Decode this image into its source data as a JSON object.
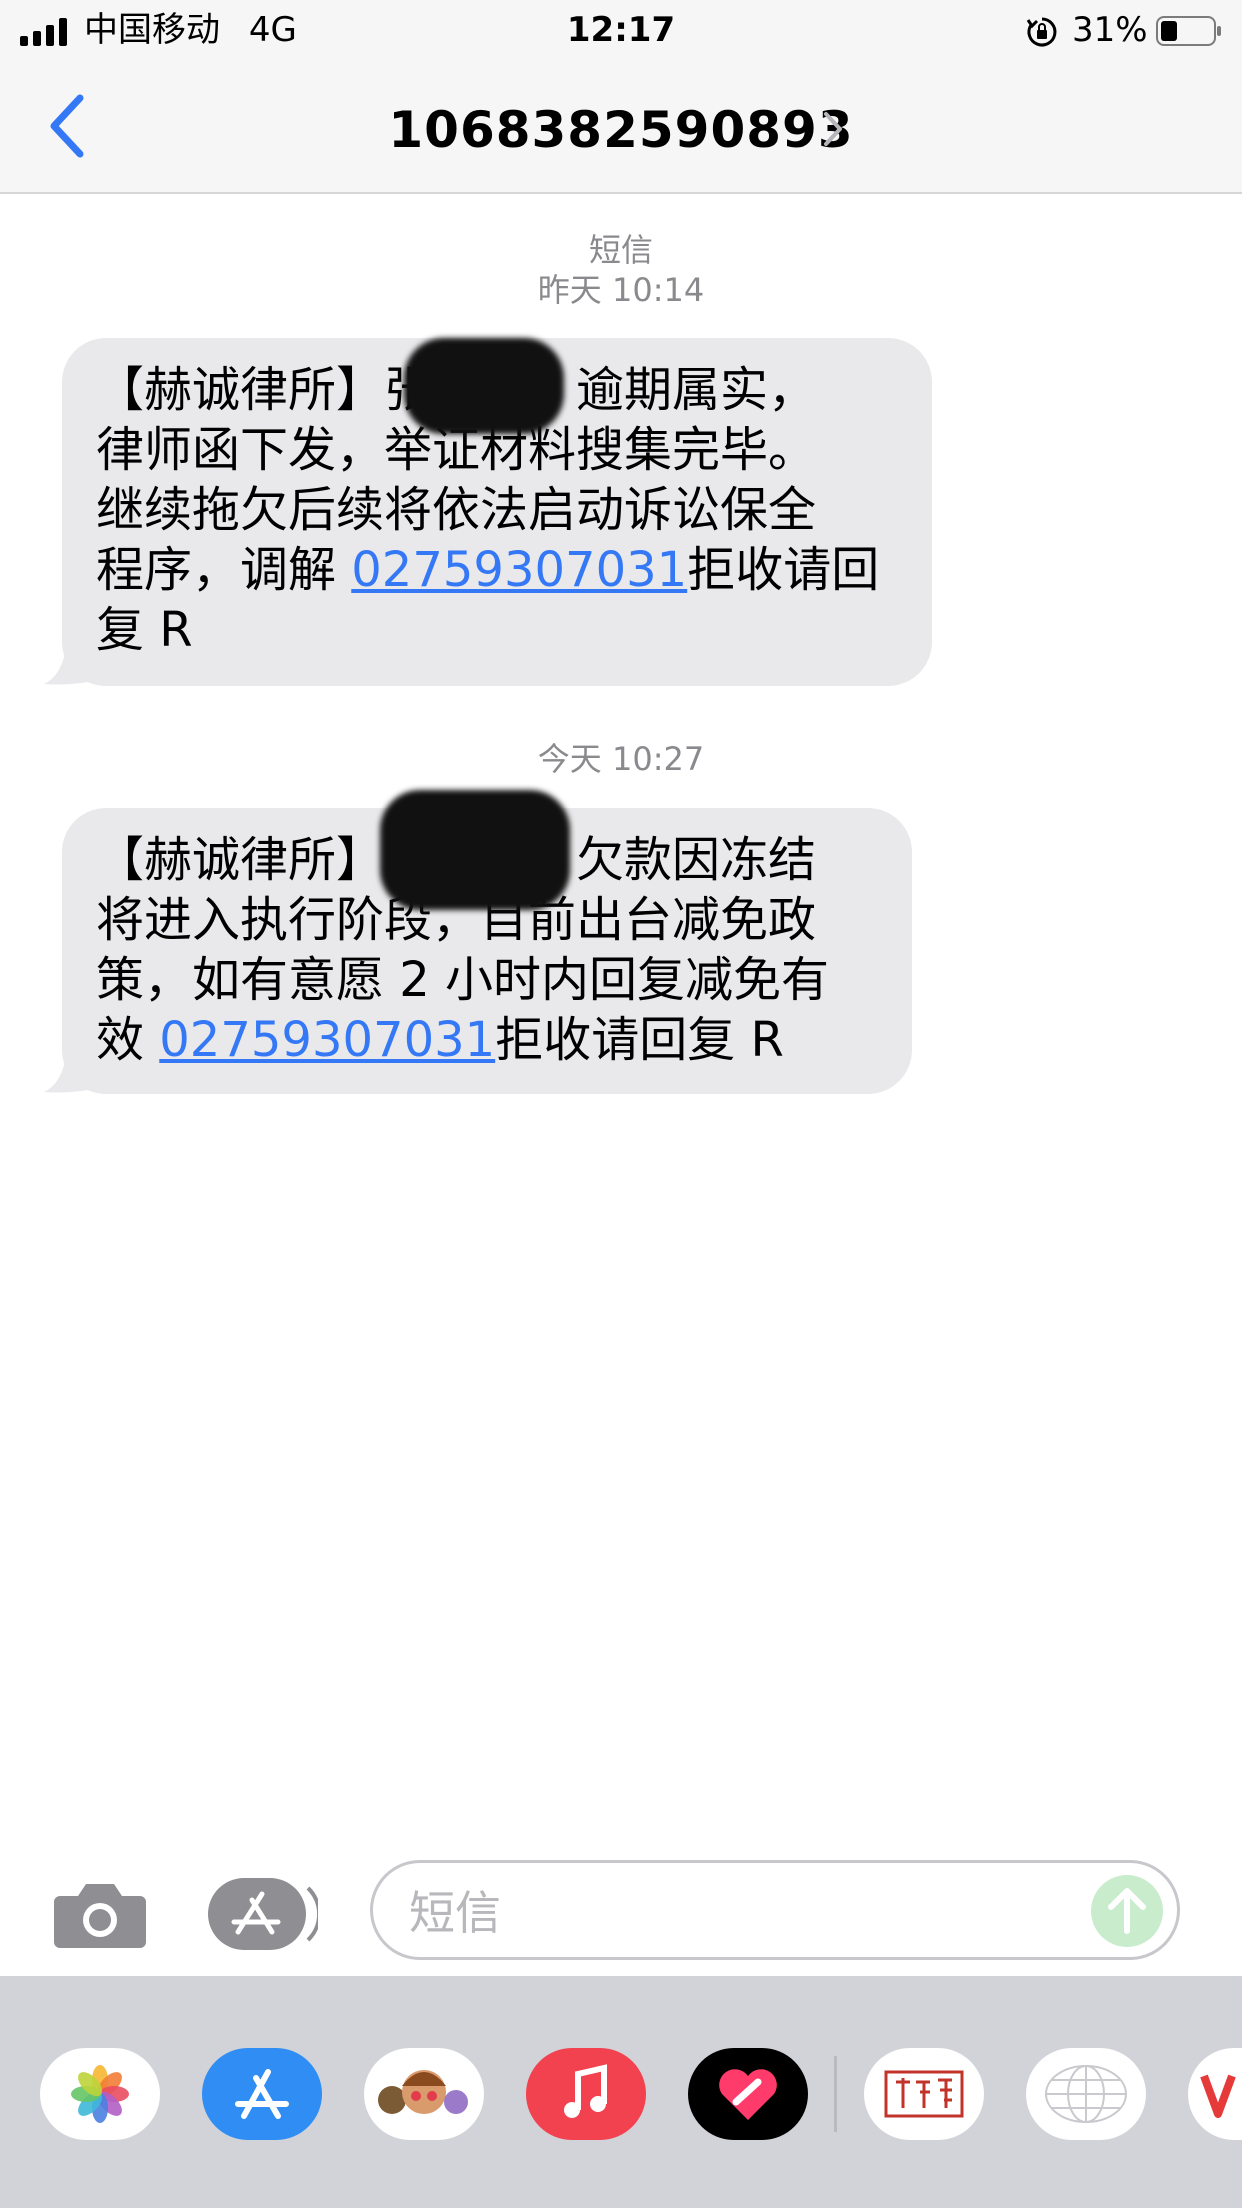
{
  "status_bar": {
    "carrier": "中国移动",
    "network": "4G",
    "time": "12:17",
    "battery_percent": "31%",
    "battery_level": 0.31
  },
  "nav": {
    "contact": "1068382590893"
  },
  "conversation": {
    "groups": [
      {
        "label": "短信",
        "timestamp": "昨天 10:14",
        "message": {
          "lines_before_link": [
            "【赫诚律所】张郭锋，逾期属实，",
            "律师函下发，举证材料搜集完毕。",
            "继续拖欠后续将依法启动诉讼保全"
          ],
          "link_line_prefix": "程序，调解 ",
          "link": "02759307031",
          "link_line_suffix": "拒收请回",
          "last_line": "复 R"
        }
      },
      {
        "timestamp": "今天 10:27",
        "message": {
          "lines_before_link": [
            "【赫诚律所】张郭锋，欠款因冻结",
            "将进入执行阶段，目前出台减免政",
            "策，如有意愿 2 小时内回复减免有"
          ],
          "link_line_prefix": "效 ",
          "link": "02759307031",
          "link_line_suffix": "拒收请回复 R"
        }
      }
    ]
  },
  "composer": {
    "placeholder": "短信"
  },
  "app_drawer": {
    "apps": [
      "photos-app",
      "app-store-app",
      "memoji-app",
      "music-app",
      "digital-touch-app",
      "calendar-stamp-app",
      "globe-sticker-app",
      "partial-app"
    ]
  },
  "colors": {
    "link": "#3478f6",
    "bubble": "#e9e9eb",
    "send_button": "#c9eccd",
    "music_app": "#f2414f"
  }
}
